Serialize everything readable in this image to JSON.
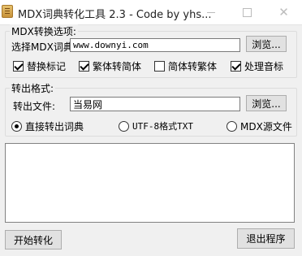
{
  "window": {
    "title": "MDX词典转化工具 2.3 - Code by yhs..."
  },
  "mdx_group": {
    "legend": "MDX转换选项:",
    "dict_label": "选择MDX词典:",
    "dict_value": "www.downyi.com",
    "browse_label": "浏览...",
    "checkboxes": [
      {
        "label": "替换标记",
        "checked": true
      },
      {
        "label": "繁体转简体",
        "checked": true
      },
      {
        "label": "简体转繁体",
        "checked": false
      },
      {
        "label": "处理音标",
        "checked": true
      }
    ]
  },
  "output_group": {
    "legend": "转出格式:",
    "file_label": "转出文件:",
    "file_value": "当易网",
    "browse_label": "浏览...",
    "radios": [
      {
        "label": "直接转出词典",
        "selected": true
      },
      {
        "label": "UTF-8格式TXT",
        "selected": false
      },
      {
        "label": "MDX源文件",
        "selected": false
      }
    ]
  },
  "log_text": "",
  "actions": {
    "start_label": "开始转化",
    "exit_label": "退出程序"
  }
}
